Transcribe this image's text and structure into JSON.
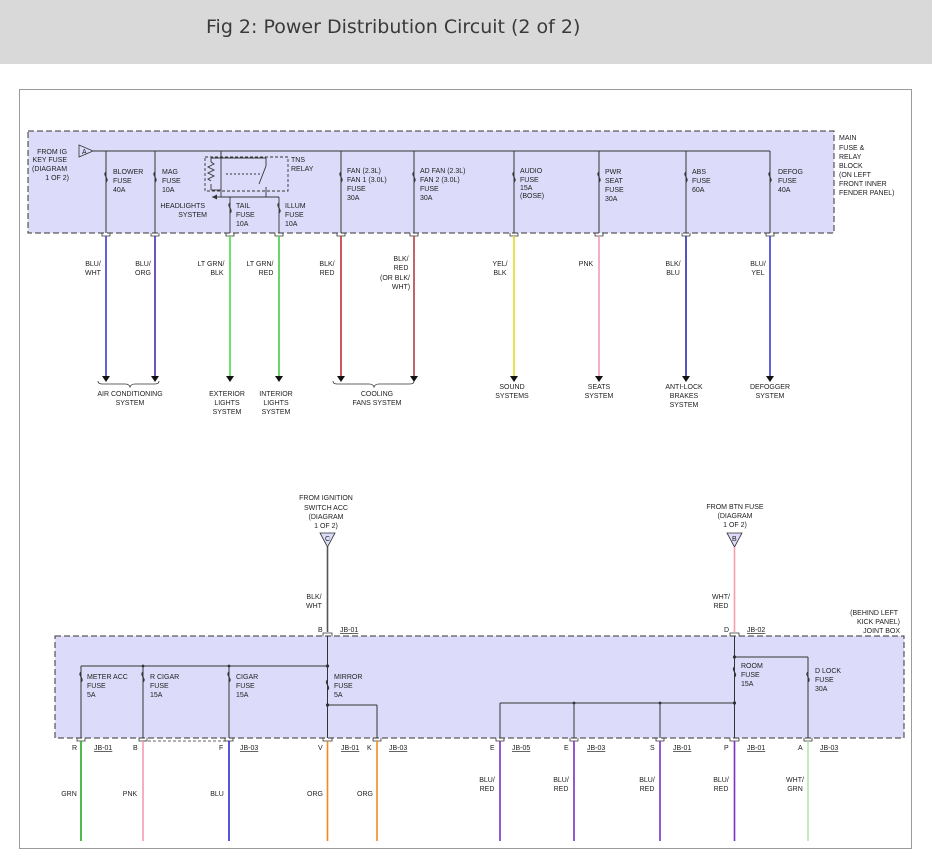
{
  "header": {
    "title": "Fig 2: Power Distribution Circuit (2 of 2)"
  },
  "colors": {
    "box_fill": "#dcdcfa",
    "blu": "#3a3ad8",
    "lt_grn": "#44dd44",
    "red": "#cc3333",
    "yel": "#dddd22",
    "pnk": "#f59ab0",
    "grn": "#22aa22",
    "org": "#f08a20",
    "purple": "#7a30c0",
    "wht_grn": "#b0e8b0"
  },
  "main_block": {
    "label": [
      "MAIN",
      "FUSE &",
      "RELAY",
      "BLOCK",
      "(ON LEFT",
      "FRONT INNER",
      "FENDER PANEL)"
    ],
    "source": [
      "FROM IG",
      "KEY FUSE",
      "(DIAGRAM",
      "1 OF 2)"
    ],
    "source_connector": "A",
    "fuses": {
      "blower": [
        "BLOWER",
        "FUSE",
        "40A"
      ],
      "mag": [
        "MAG",
        "FUSE",
        "10A"
      ],
      "tns_relay": [
        "TNS",
        "RELAY"
      ],
      "headlights": [
        "HEADLIGHTS",
        "SYSTEM"
      ],
      "tail": [
        "TAIL",
        "FUSE",
        "10A"
      ],
      "illum": [
        "ILLUM",
        "FUSE",
        "10A"
      ],
      "fan1": [
        "FAN  (2.3L)",
        "FAN 1   (3.0L)",
        "FUSE",
        "30A"
      ],
      "adfan": [
        "AD FAN  (2.3L)",
        "FAN 2   (3.0L)",
        "FUSE",
        "30A"
      ],
      "audio": [
        "AUDIO",
        "FUSE",
        "15A",
        "(BOSE)"
      ],
      "pwrseat": [
        "PWR",
        "SEAT",
        "FUSE",
        "30A"
      ],
      "abs": [
        "ABS",
        "FUSE",
        "60A"
      ],
      "defog": [
        "DEFOG",
        "FUSE",
        "40A"
      ]
    },
    "wires": {
      "w1": [
        "BLU/",
        "WHT"
      ],
      "w2": [
        "BLU/",
        "ORG"
      ],
      "w3": [
        "LT GRN/",
        "BLK"
      ],
      "w4": [
        "LT GRN/",
        "RED"
      ],
      "w5": [
        "BLK/",
        "RED"
      ],
      "w6": [
        "BLK/",
        "RED",
        "(OR BLK/",
        "WHT)"
      ],
      "w7": [
        "YEL/",
        "BLK"
      ],
      "w8": [
        "PNK"
      ],
      "w9": [
        "BLK/",
        "BLU"
      ],
      "w10": [
        "BLU/",
        "YEL"
      ]
    },
    "systems": {
      "ac": [
        "AIR CONDITIONING",
        "SYSTEM"
      ],
      "ext": [
        "EXTERIOR",
        "LIGHTS",
        "SYSTEM"
      ],
      "int": [
        "INTERIOR",
        "LIGHTS",
        "SYSTEM"
      ],
      "cool": [
        "COOLING",
        "FANS SYSTEM"
      ],
      "sound": [
        "SOUND",
        "SYSTEMS"
      ],
      "seats": [
        "SEATS",
        "SYSTEM"
      ],
      "abs": [
        "ANTI-LOCK",
        "BRAKES",
        "SYSTEM"
      ],
      "defog": [
        "DEFOGGER",
        "SYSTEM"
      ]
    }
  },
  "joint_box": {
    "label": [
      "(BEHIND LEFT",
      "KICK PANEL)",
      "JOINT BOX"
    ],
    "ign_source": [
      "FROM IGNITION",
      "SWITCH ACC",
      "(DIAGRAM",
      "1 OF 2)"
    ],
    "ign_connector": "C",
    "btn_source": [
      "FROM BTN FUSE",
      "(DIAGRAM",
      "1 OF 2)"
    ],
    "btn_connector": "B",
    "ign_wire": [
      "BLK/",
      "WHT"
    ],
    "btn_wire": [
      "WHT/",
      "RED"
    ],
    "in_pins": {
      "b": {
        "pin": "B",
        "conn": "JB-01"
      },
      "d": {
        "pin": "D",
        "conn": "JB-02"
      }
    },
    "fuses": {
      "meter": [
        "METER ACC",
        "FUSE",
        "5A"
      ],
      "rcigar": [
        "R CIGAR",
        "FUSE",
        "15A"
      ],
      "cigar": [
        "CIGAR",
        "FUSE",
        "15A"
      ],
      "mirror": [
        "MIRROR",
        "FUSE",
        "5A"
      ],
      "room": [
        "ROOM",
        "FUSE",
        "15A"
      ],
      "dlock": [
        "D LOCK",
        "FUSE",
        "30A"
      ]
    },
    "out_pins": {
      "p1": {
        "pin": "R",
        "conn": "JB-01"
      },
      "p2": {
        "pin": "B",
        "conn": ""
      },
      "p3": {
        "pin": "F",
        "conn": "JB-03"
      },
      "p4": {
        "pin": "V",
        "conn": "JB-01"
      },
      "p5": {
        "pin": "K",
        "conn": "JB-03"
      },
      "p6": {
        "pin": "E",
        "conn": "JB-05"
      },
      "p7": {
        "pin": "E",
        "conn": "JB-03"
      },
      "p8": {
        "pin": "S",
        "conn": "JB-01"
      },
      "p9": {
        "pin": "P",
        "conn": "JB-01"
      },
      "p10": {
        "pin": "A",
        "conn": "JB-03"
      }
    },
    "wires": {
      "o1": [
        "GRN"
      ],
      "o2": [
        "PNK"
      ],
      "o3": [
        "BLU"
      ],
      "o4": [
        "ORG"
      ],
      "o5": [
        "ORG"
      ],
      "o6": [
        "BLU/",
        "RED"
      ],
      "o7": [
        "BLU/",
        "RED"
      ],
      "o8": [
        "BLU/",
        "RED"
      ],
      "o9": [
        "BLU/",
        "RED"
      ],
      "o10": [
        "WHT/",
        "GRN"
      ]
    }
  }
}
